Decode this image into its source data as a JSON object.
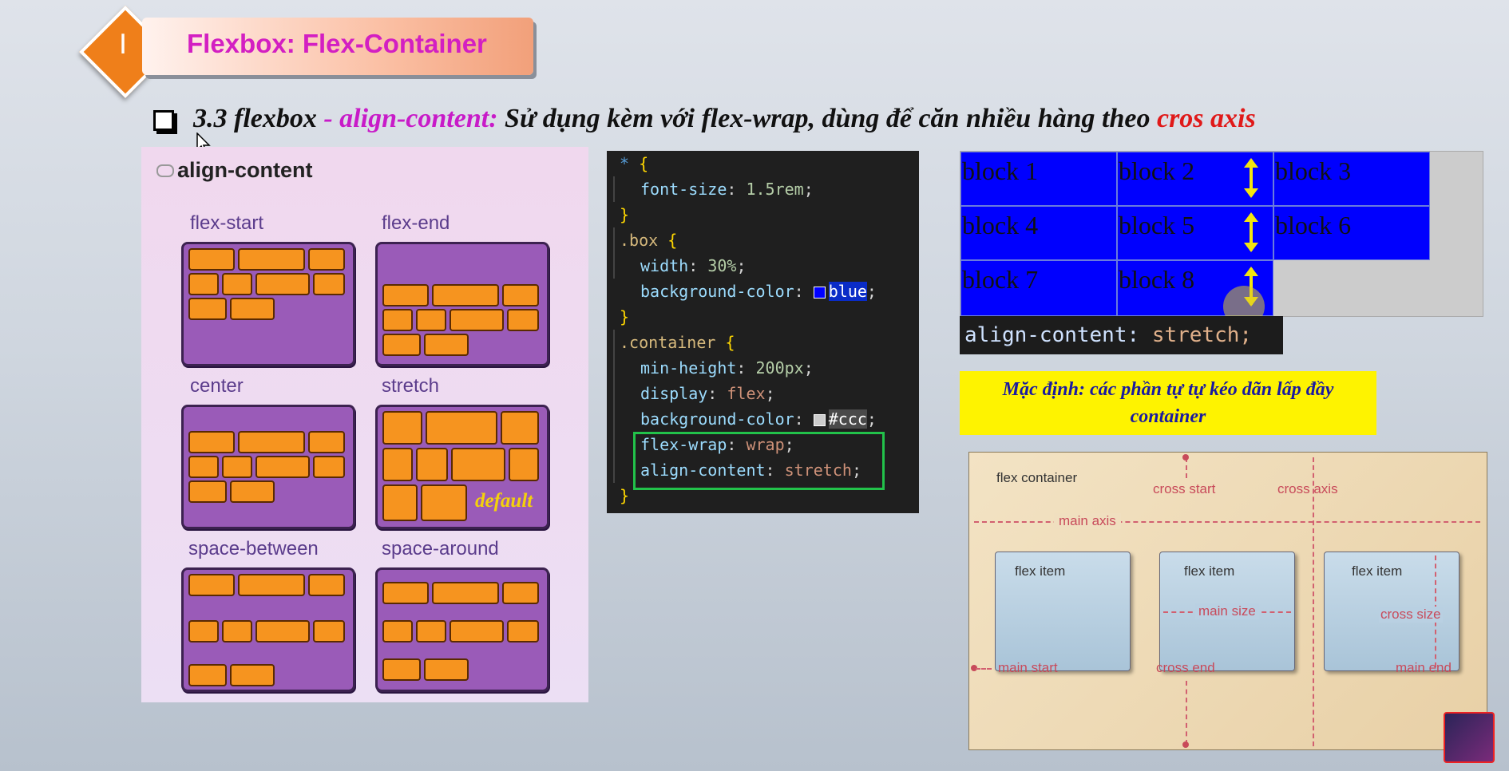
{
  "header": {
    "badge_number": "I",
    "title": "Flexbox: Flex-Container"
  },
  "subtitle": {
    "part1": "3.3 flexbox ",
    "part2": "- align-content:",
    "part3": " Sử dụng kèm với flex-wrap, dùng để căn nhiều hàng theo ",
    "part4": "cros axis"
  },
  "illustration": {
    "title": "align-content",
    "panels": [
      {
        "label": "flex-start"
      },
      {
        "label": "flex-end"
      },
      {
        "label": "center"
      },
      {
        "label": "stretch",
        "note": "default"
      },
      {
        "label": "space-between"
      },
      {
        "label": "space-around"
      }
    ]
  },
  "code": {
    "star": "*",
    "brace_open": "{",
    "brace_close": "}",
    "font_size_prop": "font-size",
    "font_size_val": "1.5rem",
    "box_sel": ".box",
    "width_prop": "width",
    "width_val": "30%",
    "bg_prop": "background-color",
    "bg_val": "blue",
    "container_sel": ".container",
    "minh_prop": "min-height",
    "minh_val": "200px",
    "display_prop": "display",
    "display_val": "flex",
    "bg2_val": "#ccc",
    "wrap_prop": "flex-wrap",
    "wrap_val": "wrap",
    "ac_prop": "align-content",
    "ac_val": "stretch",
    "colors": {
      "blue_swatch": "#0000ff",
      "ccc_swatch": "#cccccc"
    }
  },
  "demo": {
    "blocks": [
      "block 1",
      "block 2",
      "block 3",
      "block 4",
      "block 5",
      "block 6",
      "block 7",
      "block 8"
    ],
    "label_prop": "align-content:",
    "label_val": "stretch;"
  },
  "note": {
    "line1": "Mặc định: các phần tự tự kéo dãn lấp đầy",
    "line2": "container"
  },
  "diagram": {
    "container_label": "flex container",
    "cross_start": "cross start",
    "cross_axis": "cross axis",
    "main_axis": "main axis",
    "item_label": "flex item",
    "main_size": "main size",
    "cross_size": "cross size",
    "main_start": "main start",
    "cross_end": "cross end",
    "main_end": "main end"
  }
}
